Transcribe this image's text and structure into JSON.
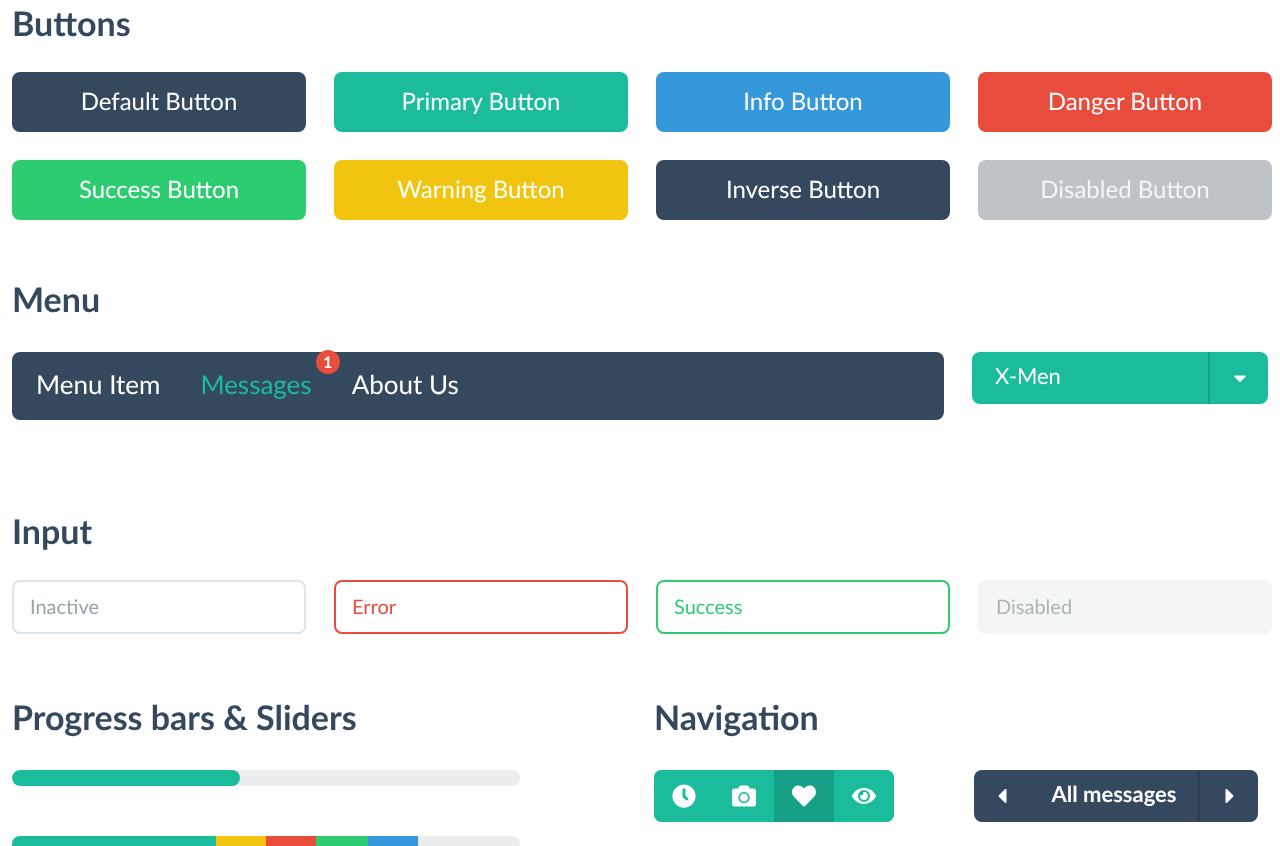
{
  "buttons_section": {
    "title": "Buttons",
    "buttons": [
      {
        "label": "Default Button",
        "kind": "default"
      },
      {
        "label": "Primary Button",
        "kind": "primary"
      },
      {
        "label": "Info Button",
        "kind": "info"
      },
      {
        "label": "Danger Button",
        "kind": "danger"
      },
      {
        "label": "Success Button",
        "kind": "success"
      },
      {
        "label": "Warning Button",
        "kind": "warning"
      },
      {
        "label": "Inverse Button",
        "kind": "inverse"
      },
      {
        "label": "Disabled Button",
        "kind": "disabled"
      }
    ]
  },
  "menu_section": {
    "title": "Menu",
    "items": [
      {
        "label": "Menu Item",
        "selected": false
      },
      {
        "label": "Messages",
        "selected": true,
        "badge": "1"
      },
      {
        "label": "About Us",
        "selected": false
      }
    ],
    "dropdown": {
      "value": "X-Men"
    }
  },
  "input_section": {
    "title": "Input",
    "inputs": [
      {
        "kind": "inactive",
        "placeholder": "Inactive"
      },
      {
        "kind": "error",
        "placeholder": "Error"
      },
      {
        "kind": "success",
        "placeholder": "Success"
      },
      {
        "kind": "disabled",
        "placeholder": "Disabled"
      }
    ]
  },
  "progress_section": {
    "title": "Progress bars & Sliders",
    "progress": {
      "level": 0.45
    },
    "stacked": [
      {
        "color": "#1abc9c"
      },
      {
        "color": "#f1c40f"
      },
      {
        "color": "#e74c3c"
      },
      {
        "color": "#2ecc71"
      },
      {
        "color": "#3498db"
      }
    ]
  },
  "navigation_section": {
    "title": "Navigation",
    "icon_tabs": [
      {
        "selected": false
      },
      {
        "selected": false
      },
      {
        "selected": true
      },
      {
        "selected": false
      }
    ],
    "pager": {
      "label": "All messages"
    }
  }
}
